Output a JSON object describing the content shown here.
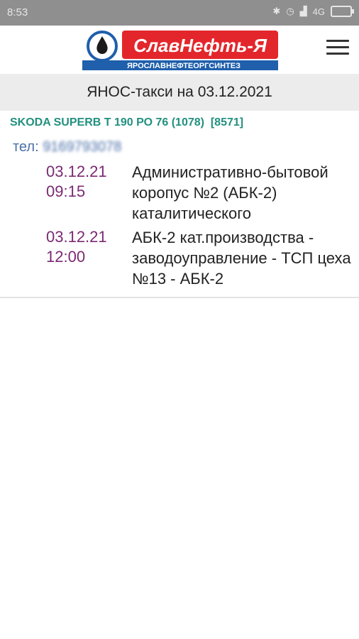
{
  "status_bar": {
    "time": "8:53",
    "network": "4G"
  },
  "header": {
    "logo_text": "СлавНефть-Я",
    "logo_subtitle": "ЯРОСЛАВНЕФТЕОРГСИНТЕЗ"
  },
  "title": "ЯНОС-такси на 03.12.2021",
  "car": {
    "label": "SKODA SUPERB Т 190 РО 76 (1078)  [8571]"
  },
  "phone": {
    "label": "тел:",
    "number": "9169793078"
  },
  "rides": [
    {
      "date": "03.12.21",
      "time": "09:15",
      "route": "Административно-бытовой коропус №2 (АБК-2) каталитического"
    },
    {
      "date": "03.12.21",
      "time": "12:00",
      "route": "АБК-2 кат.производства - заводоуправление - ТСП цеха №13 - АБК-2"
    }
  ],
  "colors": {
    "car_text": "#22907f",
    "ride_date": "#7a2a72",
    "logo_red": "#e3262b",
    "logo_blue": "#1f5fab",
    "title_bg": "#ececec"
  }
}
